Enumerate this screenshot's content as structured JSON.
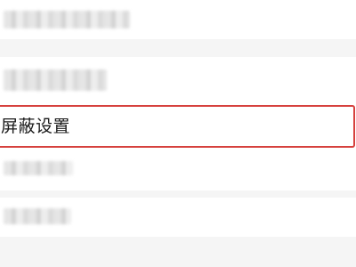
{
  "settings_list": {
    "items": [
      {
        "label": "",
        "redacted": true
      },
      {
        "label": "",
        "redacted": true
      },
      {
        "label": "屏蔽设置",
        "redacted": false,
        "highlighted": true
      },
      {
        "label": "",
        "redacted": true
      },
      {
        "label": "",
        "redacted": true
      }
    ],
    "highlight_color": "#d6413e"
  }
}
